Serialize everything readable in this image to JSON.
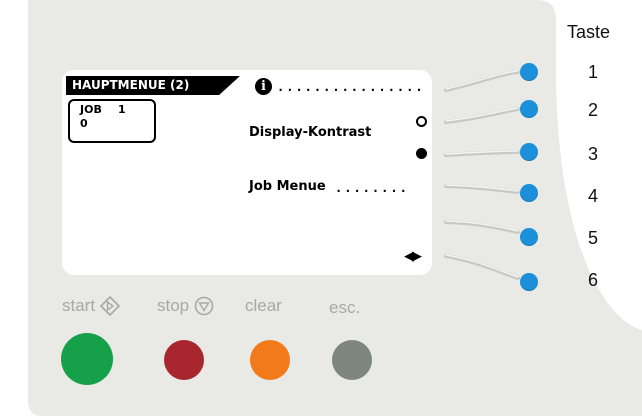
{
  "header": {
    "key_heading": "Taste"
  },
  "display": {
    "menu_title": "HAUPTMENUE (2)",
    "job": {
      "label": "JOB",
      "number": "1",
      "value": "0"
    },
    "info_glyph": "i",
    "line1_dots": "................",
    "line2_label": "Display-Kontrast",
    "line4_label": "Job Menue",
    "line4_dots": "........",
    "nav_arrows": "◀▶"
  },
  "side_keys": [
    {
      "number": "1"
    },
    {
      "number": "2"
    },
    {
      "number": "3"
    },
    {
      "number": "4"
    },
    {
      "number": "5"
    },
    {
      "number": "6"
    }
  ],
  "controls": {
    "start_label": "start",
    "stop_label": "stop",
    "clear_label": "clear",
    "esc_label": "esc."
  },
  "colors": {
    "panel": "#e9e9e5",
    "panel_edge": "#dcdcd8",
    "key_blue": "#1b8fd9",
    "start_green": "#16a04a",
    "stop_red": "#a8262e",
    "clear_orange": "#f27a1a",
    "esc_gray": "#7d857f"
  }
}
